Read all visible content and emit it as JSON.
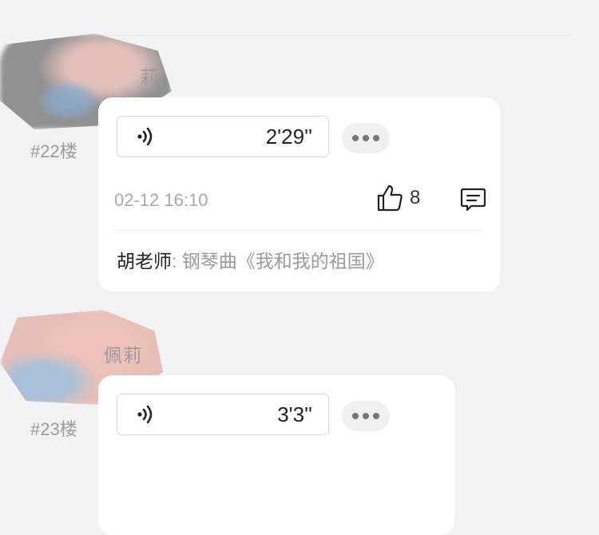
{
  "posts": [
    {
      "username": "莉",
      "floor": "#22楼",
      "voice_duration": "2'29''",
      "time": "02-12 16:10",
      "likes": "8",
      "reply": {
        "author": "胡老师",
        "separator": ": ",
        "text": "钢琴曲《我和我的祖国》"
      }
    },
    {
      "username": "佩莉",
      "floor": "#23楼",
      "voice_duration": "3'3''"
    }
  ],
  "icons": {
    "voice": "voice-wave-icon",
    "more": "more-dots-icon",
    "like": "thumbs-up-icon",
    "comment": "comment-icon"
  },
  "colors": {
    "background": "#f2f2f5",
    "card": "#ffffff",
    "muted_text": "#9a9a9e"
  }
}
